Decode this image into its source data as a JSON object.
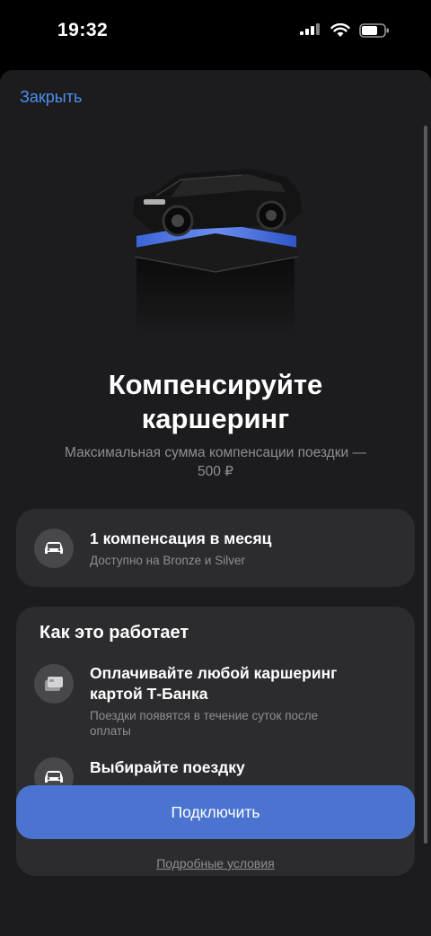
{
  "status_bar": {
    "time": "19:32"
  },
  "header": {
    "close_label": "Закрыть"
  },
  "hero": {
    "icon": "car-on-platform-illustration"
  },
  "main": {
    "title_line1": "Компенсируйте",
    "title_line2": "каршеринг",
    "subtitle_line1": "Максимальная сумма компенсации поездки —",
    "subtitle_line2": "500 ₽"
  },
  "compensation_card": {
    "icon": "car-icon",
    "title": "1 компенсация в месяц",
    "subtitle": "Доступно на Bronze и Silver"
  },
  "how_it_works": {
    "title": "Как это работает",
    "steps": [
      {
        "icon": "bank-card-icon",
        "title_line1": "Оплачивайте любой каршеринг",
        "title_line2": "картой Т-Банка",
        "subtitle_line1": "Поездки появятся в течение суток после",
        "subtitle_line2": "оплаты"
      },
      {
        "icon": "car-icon",
        "title": "Выбирайте поездку"
      }
    ]
  },
  "footer": {
    "connect_label": "Подключить",
    "terms_label": "Подробные условия"
  },
  "colors": {
    "accent_link": "#4d8ef0",
    "button": "#4a74d0",
    "sheet_bg": "#1c1c1e",
    "card_bg": "#2c2c2e"
  }
}
